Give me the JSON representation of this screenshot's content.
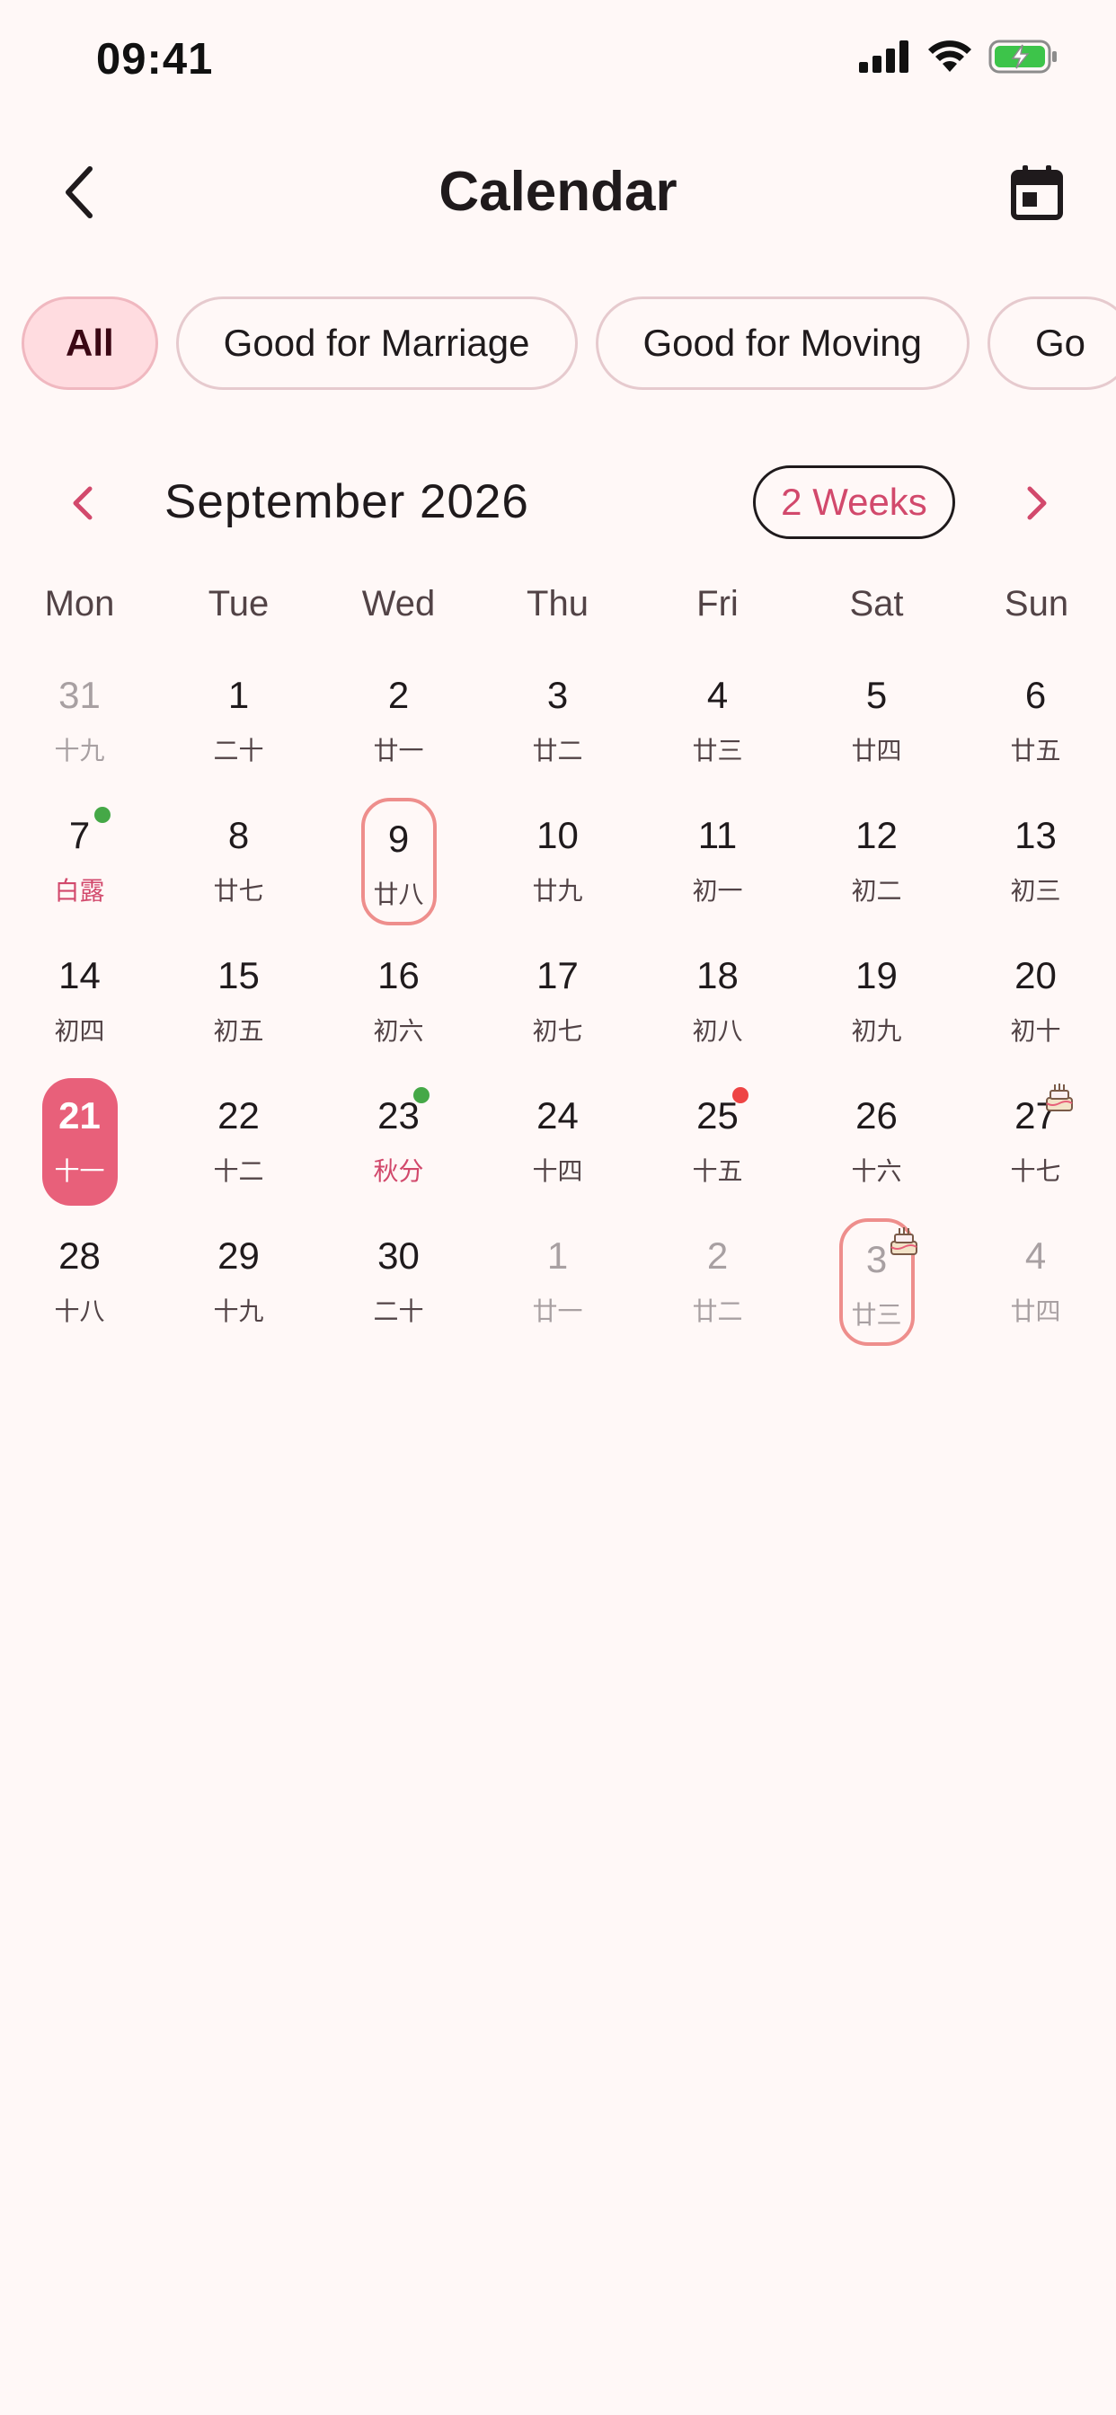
{
  "status_bar": {
    "time": "09:41"
  },
  "header": {
    "title": "Calendar"
  },
  "filters": [
    "All",
    "Good for Marriage",
    "Good for Moving",
    "Go"
  ],
  "month_nav": {
    "label": "September 2026",
    "range_toggle": "2 Weeks"
  },
  "weekdays": [
    "Mon",
    "Tue",
    "Wed",
    "Thu",
    "Fri",
    "Sat",
    "Sun"
  ],
  "weeks": [
    [
      {
        "day": "31",
        "lunar": "十九",
        "other": true
      },
      {
        "day": "1",
        "lunar": "二十"
      },
      {
        "day": "2",
        "lunar": "廿一"
      },
      {
        "day": "3",
        "lunar": "廿二"
      },
      {
        "day": "4",
        "lunar": "廿三"
      },
      {
        "day": "5",
        "lunar": "廿四"
      },
      {
        "day": "6",
        "lunar": "廿五"
      }
    ],
    [
      {
        "day": "7",
        "lunar": "白露",
        "term": true,
        "dot": "green"
      },
      {
        "day": "8",
        "lunar": "廿七"
      },
      {
        "day": "9",
        "lunar": "廿八",
        "outlined": true
      },
      {
        "day": "10",
        "lunar": "廿九"
      },
      {
        "day": "11",
        "lunar": "初一"
      },
      {
        "day": "12",
        "lunar": "初二"
      },
      {
        "day": "13",
        "lunar": "初三"
      }
    ],
    [
      {
        "day": "14",
        "lunar": "初四"
      },
      {
        "day": "15",
        "lunar": "初五"
      },
      {
        "day": "16",
        "lunar": "初六"
      },
      {
        "day": "17",
        "lunar": "初七"
      },
      {
        "day": "18",
        "lunar": "初八"
      },
      {
        "day": "19",
        "lunar": "初九"
      },
      {
        "day": "20",
        "lunar": "初十"
      }
    ],
    [
      {
        "day": "21",
        "lunar": "十一",
        "today": true
      },
      {
        "day": "22",
        "lunar": "十二"
      },
      {
        "day": "23",
        "lunar": "秋分",
        "term": true,
        "dot": "green"
      },
      {
        "day": "24",
        "lunar": "十四"
      },
      {
        "day": "25",
        "lunar": "十五",
        "dot": "red"
      },
      {
        "day": "26",
        "lunar": "十六"
      },
      {
        "day": "27",
        "lunar": "十七",
        "icon": "birthday-cake-icon"
      }
    ],
    [
      {
        "day": "28",
        "lunar": "十八"
      },
      {
        "day": "29",
        "lunar": "十九"
      },
      {
        "day": "30",
        "lunar": "二十"
      },
      {
        "day": "1",
        "lunar": "廿一",
        "other": true
      },
      {
        "day": "2",
        "lunar": "廿二",
        "other": true
      },
      {
        "day": "3",
        "lunar": "廿三",
        "other": true,
        "outlined": true,
        "icon": "birthday-cake-icon"
      },
      {
        "day": "4",
        "lunar": "廿四",
        "other": true
      }
    ]
  ],
  "colors": {
    "accent": "#D2496C",
    "today_bg": "#E8607A",
    "outline": "#EE8E8C",
    "dot_green": "#45A847",
    "dot_red": "#EE4444",
    "chip_selected_bg": "#FFDCE0",
    "background": "#FFF8F7"
  }
}
